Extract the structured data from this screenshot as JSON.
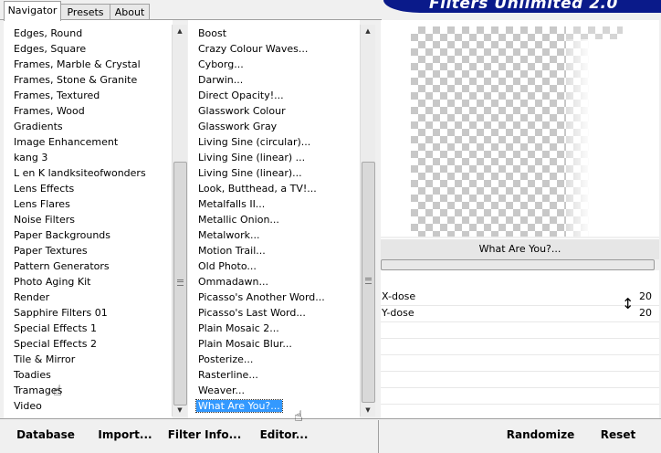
{
  "tabs": [
    {
      "label": "Navigator",
      "active": true
    },
    {
      "label": "Presets",
      "active": false
    },
    {
      "label": "About",
      "active": false
    }
  ],
  "banner": {
    "title": "Filters Unlimited 2.0"
  },
  "categories": {
    "items": [
      "Edges, Round",
      "Edges, Square",
      "Frames, Marble & Crystal",
      "Frames, Stone & Granite",
      "Frames, Textured",
      "Frames, Wood",
      "Gradients",
      "Image Enhancement",
      "kang 3",
      "L en K landksiteofwonders",
      "Lens Effects",
      "Lens Flares",
      "Noise Filters",
      "Paper Backgrounds",
      "Paper Textures",
      "Pattern Generators",
      "Photo Aging Kit",
      "Render",
      "Sapphire Filters 01",
      "Special Effects 1",
      "Special Effects 2",
      "Tile & Mirror",
      "Toadies",
      "Tramages",
      "Video"
    ],
    "hovered": "Toadies"
  },
  "filters": {
    "items": [
      "Boost",
      "Crazy Colour Waves...",
      "Cyborg...",
      "Darwin...",
      "Direct Opacity!...",
      "Glasswork Colour",
      "Glasswork Gray",
      "Living Sine (circular)...",
      "Living Sine (linear) ...",
      "Living Sine (linear)...",
      "Look, Butthead, a TV!...",
      "Metalfalls II...",
      "Metallic Onion...",
      "Metalwork...",
      "Motion Trail...",
      "Old Photo...",
      "Ommadawn...",
      "Picasso's Another Word...",
      "Picasso's Last Word...",
      "Plain Mosaic 2...",
      "Plain Mosaic Blur...",
      "Posterize...",
      "Rasterline...",
      "Weaver...",
      "What Are You?..."
    ],
    "selected": "What Are You?..."
  },
  "preview": {
    "filter_name": "What Are You?..."
  },
  "controls": [
    {
      "label": "X-dose",
      "value": "20"
    },
    {
      "label": "Y-dose",
      "value": "20"
    }
  ],
  "buttons": {
    "database": "Database",
    "import": "Import...",
    "filter_info": "Filter Info...",
    "editor": "Editor...",
    "randomize": "Randomize",
    "reset": "Reset"
  }
}
